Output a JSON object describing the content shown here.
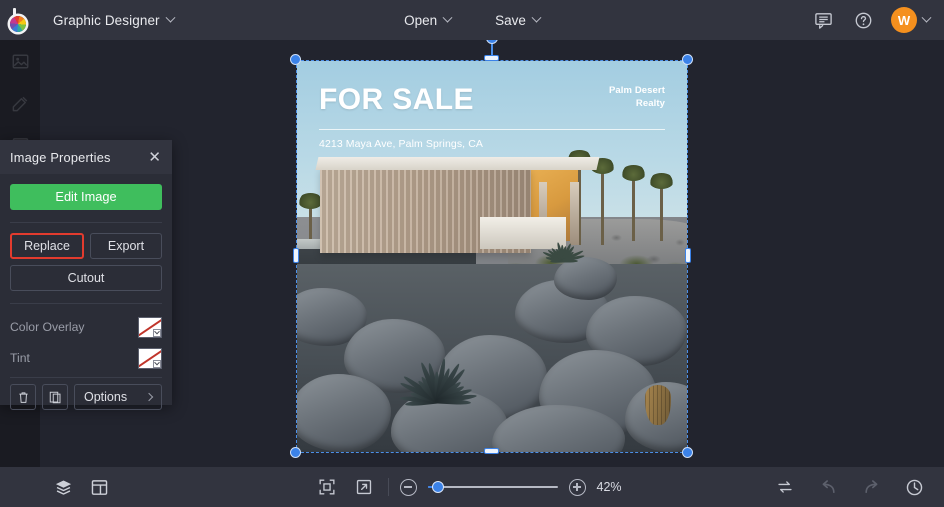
{
  "app": {
    "logo_icon": "befunky-logo-icon",
    "mode_label": "Graphic Designer",
    "mode_caret_icon": "chevron-down-icon"
  },
  "topbar": {
    "open_label": "Open",
    "open_caret_icon": "chevron-down-icon",
    "save_label": "Save",
    "save_caret_icon": "chevron-down-icon",
    "feedback_icon": "chat-bubble-icon",
    "help_icon": "question-mark-circle-icon",
    "avatar_initial": "W",
    "avatar_color": "#f5901e",
    "avatar_caret_icon": "chevron-down-icon"
  },
  "rail": {
    "items": [
      {
        "name": "image-manager",
        "icon": "photo-icon"
      },
      {
        "name": "graphics",
        "icon": "edit-tool-icon"
      },
      {
        "name": "templates",
        "icon": "columns-layout-icon"
      }
    ]
  },
  "panel": {
    "title": "Image Properties",
    "close_icon": "close-icon",
    "edit_image_label": "Edit Image",
    "edit_image_color": "#3fbe5d",
    "replace_label": "Replace",
    "replace_highlight_color": "#e23b2e",
    "export_label": "Export",
    "cutout_label": "Cutout",
    "color_overlay_label": "Color Overlay",
    "color_overlay_value": "none",
    "tint_label": "Tint",
    "tint_value": "none",
    "delete_icon": "trash-icon",
    "duplicate_icon": "duplicate-icon",
    "options_label": "Options",
    "options_caret_icon": "chevron-right-icon"
  },
  "canvas": {
    "selection_accent": "#3b82e8",
    "rotate_handle_icon": "rotate-handle-icon",
    "poster": {
      "headline": "FOR SALE",
      "brand_line1": "Palm Desert",
      "brand_line2": "Realty",
      "address": "4213 Maya Ave, Palm Springs, CA",
      "sky_color": "#a9cfe2"
    }
  },
  "bottombar": {
    "layers_icon": "layers-icon",
    "template_icon": "template-grid-icon",
    "fit_icon": "fit-to-screen-icon",
    "fullscreen_icon": "expand-arrow-icon",
    "zoom_out_icon": "minus-circle-icon",
    "zoom_in_icon": "plus-circle-icon",
    "zoom_value": "42%",
    "zoom_percent": 8,
    "swap_icon": "swap-arrows-icon",
    "undo_icon": "undo-arrow-icon",
    "redo_icon": "redo-arrow-icon",
    "history_icon": "clock-history-icon"
  }
}
